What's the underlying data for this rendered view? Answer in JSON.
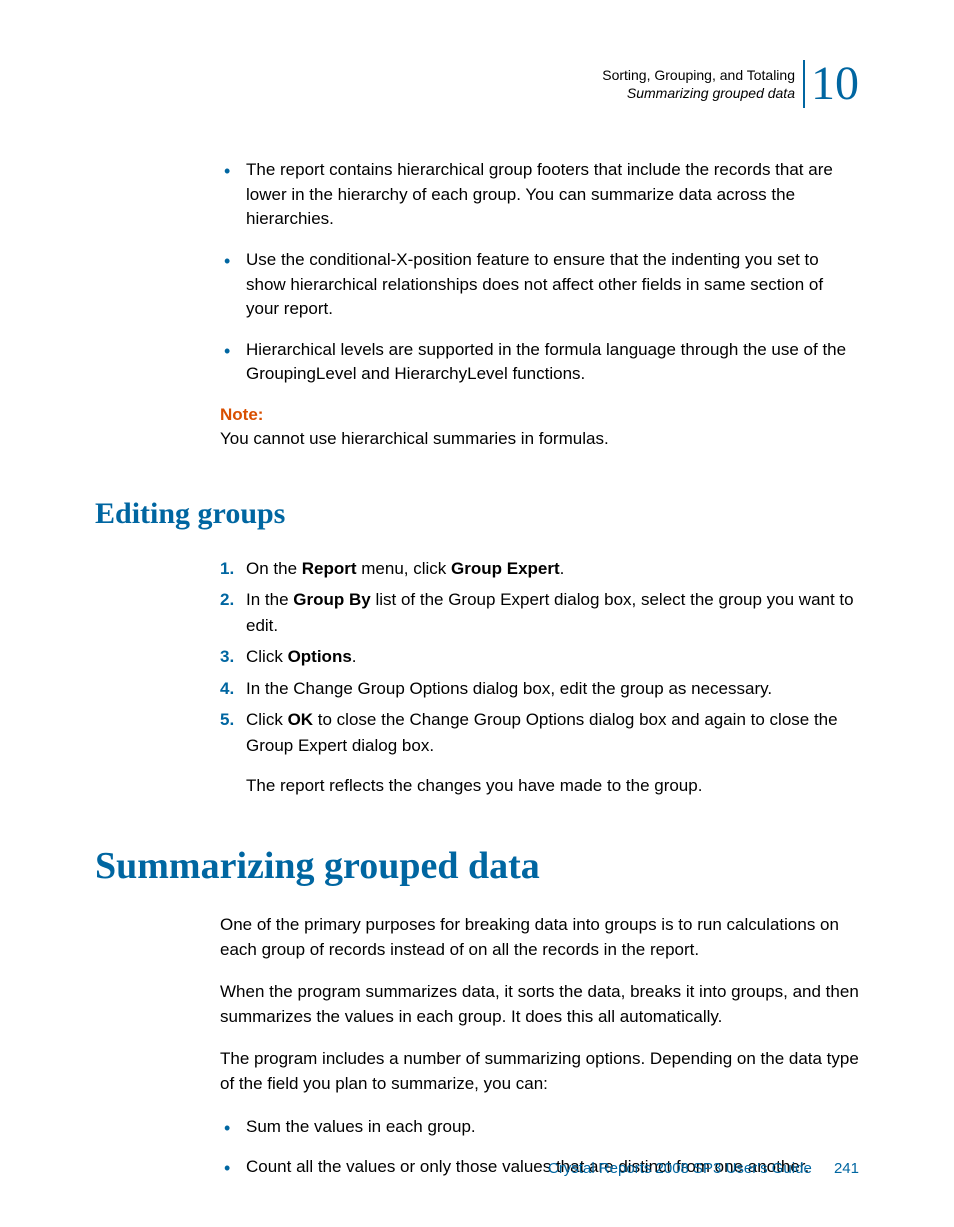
{
  "header": {
    "line1": "Sorting, Grouping, and Totaling",
    "line2": "Summarizing grouped data",
    "chapter_number": "10"
  },
  "bullets_intro": [
    "The report contains hierarchical group footers that include the records that are lower in the hierarchy of each group. You can summarize data across the hierarchies.",
    "Use the conditional-X-position feature to ensure that the indenting you set to show hierarchical relationships does not affect other fields in same section of your report.",
    "Hierarchical levels are supported in the formula language through the use of the GroupingLevel and HierarchyLevel functions."
  ],
  "note": {
    "label": "Note:",
    "text": "You cannot use hierarchical summaries in formulas."
  },
  "h2": "Editing groups",
  "steps": [
    {
      "num": "1.",
      "pre": "On the ",
      "b1": "Report",
      "mid": " menu, click ",
      "b2": "Group Expert",
      "post": "."
    },
    {
      "num": "2.",
      "pre": "In the ",
      "b1": "Group By",
      "mid": " list of the Group Expert dialog box, select the group you want to edit.",
      "b2": "",
      "post": ""
    },
    {
      "num": "3.",
      "pre": "Click ",
      "b1": "Options",
      "mid": ".",
      "b2": "",
      "post": ""
    },
    {
      "num": "4.",
      "pre": "In the Change Group Options dialog box, edit the group as necessary.",
      "b1": "",
      "mid": "",
      "b2": "",
      "post": ""
    },
    {
      "num": "5.",
      "pre": "Click ",
      "b1": "OK",
      "mid": " to close the Change Group Options dialog box and again to close the Group Expert dialog box.",
      "b2": "",
      "post": ""
    }
  ],
  "steps_result": "The report reflects the changes you have made to the group.",
  "h1": "Summarizing grouped data",
  "paras": [
    "One of the primary purposes for breaking data into groups is to run calculations on each group of records instead of on all the records in the report.",
    "When the program summarizes data, it sorts the data, breaks it into groups, and then summarizes the values in each group. It does this all automatically.",
    "The program includes a number of summarizing options. Depending on the data type of the field you plan to summarize, you can:"
  ],
  "bullets_summary": [
    "Sum the values in each group.",
    "Count all the values or only those values that are distinct from one another."
  ],
  "footer": {
    "guide": "Crystal Reports 2008 SP3 User's Guide",
    "page": "241"
  }
}
